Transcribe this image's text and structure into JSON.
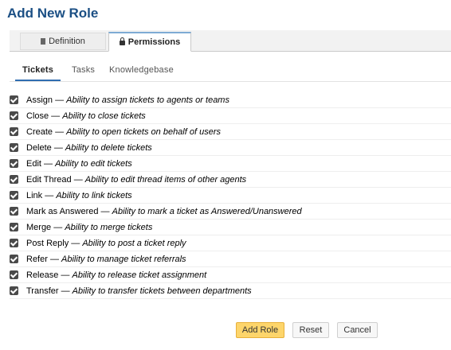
{
  "page": {
    "title": "Add New Role"
  },
  "main_tabs": [
    {
      "label": "Definition",
      "icon": "document-icon",
      "active": false
    },
    {
      "label": "Permissions",
      "icon": "lock-icon",
      "active": true
    }
  ],
  "sub_tabs": [
    {
      "label": "Tickets",
      "active": true
    },
    {
      "label": "Tasks",
      "active": false
    },
    {
      "label": "Knowledgebase",
      "active": false
    }
  ],
  "permissions": [
    {
      "name": "Assign",
      "desc": "Ability to assign tickets to agents or teams",
      "checked": true
    },
    {
      "name": "Close",
      "desc": "Ability to close tickets",
      "checked": true
    },
    {
      "name": "Create",
      "desc": "Ability to open tickets on behalf of users",
      "checked": true
    },
    {
      "name": "Delete",
      "desc": "Ability to delete tickets",
      "checked": true
    },
    {
      "name": "Edit",
      "desc": "Ability to edit tickets",
      "checked": true
    },
    {
      "name": "Edit Thread",
      "desc": "Ability to edit thread items of other agents",
      "checked": true
    },
    {
      "name": "Link",
      "desc": "Ability to link tickets",
      "checked": true
    },
    {
      "name": "Mark as Answered",
      "desc": "Ability to mark a ticket as Answered/Unanswered",
      "checked": true
    },
    {
      "name": "Merge",
      "desc": "Ability to merge tickets",
      "checked": true
    },
    {
      "name": "Post Reply",
      "desc": "Ability to post a ticket reply",
      "checked": true
    },
    {
      "name": "Refer",
      "desc": "Ability to manage ticket referrals",
      "checked": true
    },
    {
      "name": "Release",
      "desc": "Ability to release ticket assignment",
      "checked": true
    },
    {
      "name": "Transfer",
      "desc": "Ability to transfer tickets between departments",
      "checked": true
    }
  ],
  "separator": "—",
  "buttons": {
    "add_role": "Add Role",
    "reset": "Reset",
    "cancel": "Cancel"
  },
  "colors": {
    "title": "#1b4f84",
    "primary_button": "#fdd56b",
    "active_tab_accent": "#2f6db0"
  }
}
